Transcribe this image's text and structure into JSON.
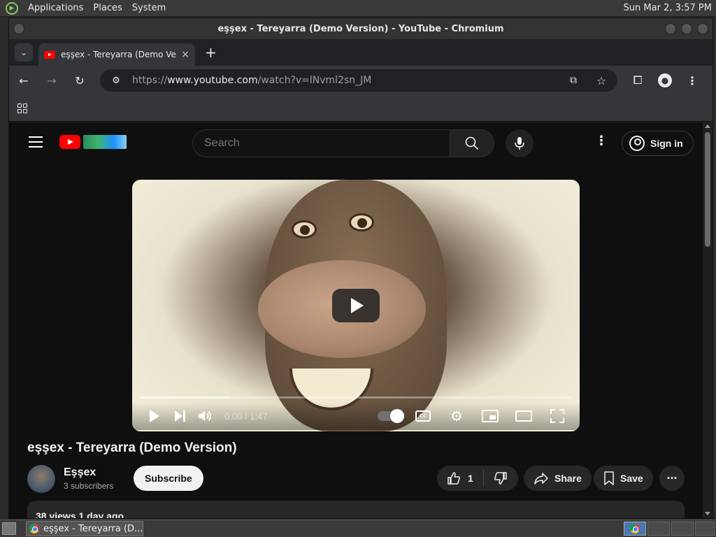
{
  "top_panel": {
    "menus": [
      "Applications",
      "Places",
      "System"
    ],
    "clock": "Sun Mar  2,  3:57 PM"
  },
  "window": {
    "title": "eşşex - Tereyarra (Demo Version) - YouTube - Chromium"
  },
  "tab": {
    "title": "eşşex - Tereyarra (Demo Vers",
    "close": "×",
    "new_tab": "+"
  },
  "omnibox": {
    "scheme": "https://",
    "host": "www.youtube.com",
    "path": "/watch?v=lNvml2sn_JM"
  },
  "youtube": {
    "search_placeholder": "Search",
    "sign_in": "Sign in",
    "menu_dots": "⋮"
  },
  "player": {
    "time": "0:00 / 1:47",
    "cc_label": "CC",
    "progress_fraction": 0.21
  },
  "video": {
    "title": "eşşex - Tereyarra (Demo Version)",
    "channel_name": "Eşşex",
    "subscribers": "3 subscribers",
    "subscribe_label": "Subscribe",
    "like_count": "1",
    "share_label": "Share",
    "save_label": "Save",
    "more_label": "···",
    "views_date": "38 views  1 day ago"
  },
  "taskbar": {
    "task_title": "eşşex - Tereyarra (D..."
  },
  "colors": {
    "youtube_red": "#ff0000",
    "page_bg": "#0f0f0f",
    "chrome_toolbar": "#35363a"
  }
}
